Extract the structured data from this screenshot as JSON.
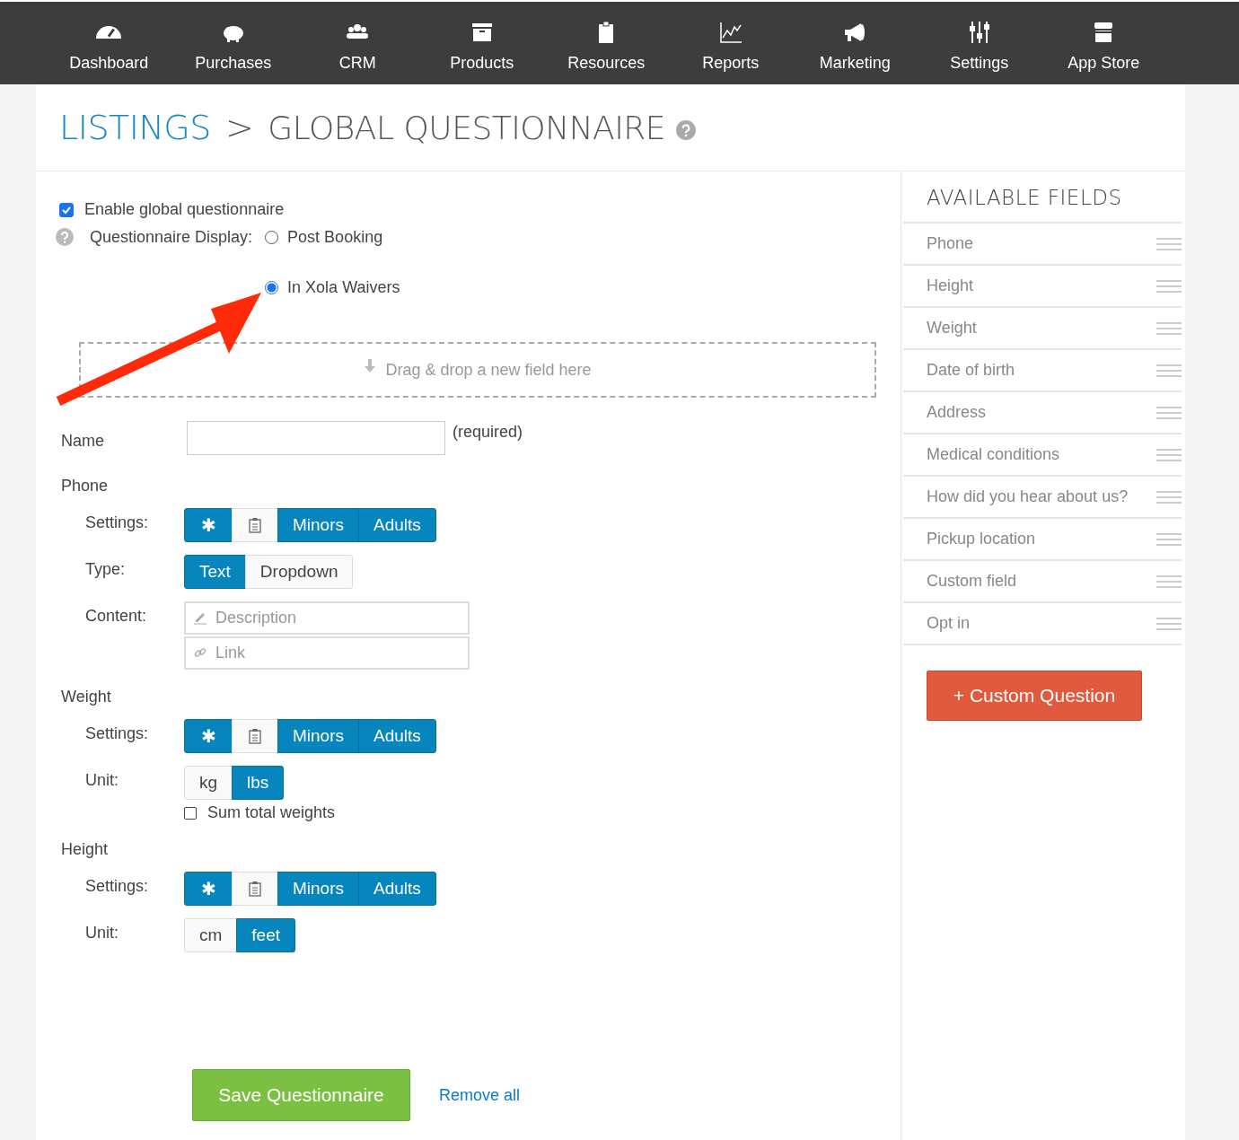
{
  "nav": [
    {
      "label": "Dashboard"
    },
    {
      "label": "Purchases"
    },
    {
      "label": "CRM"
    },
    {
      "label": "Products"
    },
    {
      "label": "Resources"
    },
    {
      "label": "Reports"
    },
    {
      "label": "Marketing"
    },
    {
      "label": "Settings"
    },
    {
      "label": "App Store"
    }
  ],
  "breadcrumb": {
    "parent": "LISTINGS",
    "separator": ">",
    "current": "GLOBAL QUESTIONNAIRE"
  },
  "enable": {
    "label": "Enable global questionnaire",
    "checked": true
  },
  "display": {
    "label": "Questionnaire Display:",
    "options": [
      {
        "label": "Post Booking",
        "selected": false
      },
      {
        "label": "In Xola Waivers",
        "selected": true
      }
    ]
  },
  "dropzone": {
    "text": "Drag & drop a new field here"
  },
  "name_field": {
    "label": "Name",
    "hint": "(required)"
  },
  "sections": [
    {
      "title": "Phone",
      "rows": [
        {
          "kind": "buttons",
          "label": "Settings:",
          "options": [
            {
              "kind": "required",
              "label": "✱",
              "selected": true
            },
            {
              "kind": "clipboard",
              "selected": false
            },
            {
              "kind": "text",
              "label": "Minors",
              "selected": true
            },
            {
              "kind": "text",
              "label": "Adults",
              "selected": true
            }
          ]
        },
        {
          "kind": "buttons",
          "label": "Type:",
          "options": [
            {
              "kind": "text",
              "label": "Text",
              "selected": true
            },
            {
              "kind": "text",
              "label": "Dropdown",
              "selected": false
            }
          ]
        },
        {
          "kind": "inputs",
          "label": "Content:",
          "inputs": [
            {
              "kind": "pencil",
              "placeholder": "Description"
            },
            {
              "kind": "link",
              "placeholder": "Link"
            }
          ]
        }
      ]
    },
    {
      "title": "Weight",
      "rows": [
        {
          "kind": "buttons",
          "label": "Settings:",
          "options": [
            {
              "kind": "required",
              "label": "✱",
              "selected": true
            },
            {
              "kind": "clipboard",
              "selected": false
            },
            {
              "kind": "text",
              "label": "Minors",
              "selected": true
            },
            {
              "kind": "text",
              "label": "Adults",
              "selected": true
            }
          ]
        },
        {
          "kind": "buttons",
          "label": "Unit:",
          "options": [
            {
              "kind": "text",
              "label": "kg",
              "selected": false
            },
            {
              "kind": "text",
              "label": "lbs",
              "selected": true
            }
          ],
          "checkbox": {
            "label": "Sum total weights",
            "checked": false
          }
        }
      ]
    },
    {
      "title": "Height",
      "rows": [
        {
          "kind": "buttons",
          "label": "Settings:",
          "options": [
            {
              "kind": "required",
              "label": "✱",
              "selected": true
            },
            {
              "kind": "clipboard",
              "selected": false
            },
            {
              "kind": "text",
              "label": "Minors",
              "selected": true
            },
            {
              "kind": "text",
              "label": "Adults",
              "selected": true
            }
          ]
        },
        {
          "kind": "buttons",
          "label": "Unit:",
          "options": [
            {
              "kind": "text",
              "label": "cm",
              "selected": false
            },
            {
              "kind": "text",
              "label": "feet",
              "selected": true
            }
          ]
        }
      ]
    }
  ],
  "save_button": "Save Questionnaire",
  "remove_link": "Remove all",
  "available": {
    "title": "AVAILABLE FIELDS",
    "items": [
      {
        "label": "Phone"
      },
      {
        "label": "Height"
      },
      {
        "label": "Weight"
      },
      {
        "label": "Date of birth"
      },
      {
        "label": "Address"
      },
      {
        "label": "Medical conditions"
      },
      {
        "label": "How did you hear about us?"
      },
      {
        "label": "Pickup location"
      },
      {
        "label": "Custom field"
      },
      {
        "label": "Opt in"
      }
    ],
    "button": "+ Custom Question"
  }
}
